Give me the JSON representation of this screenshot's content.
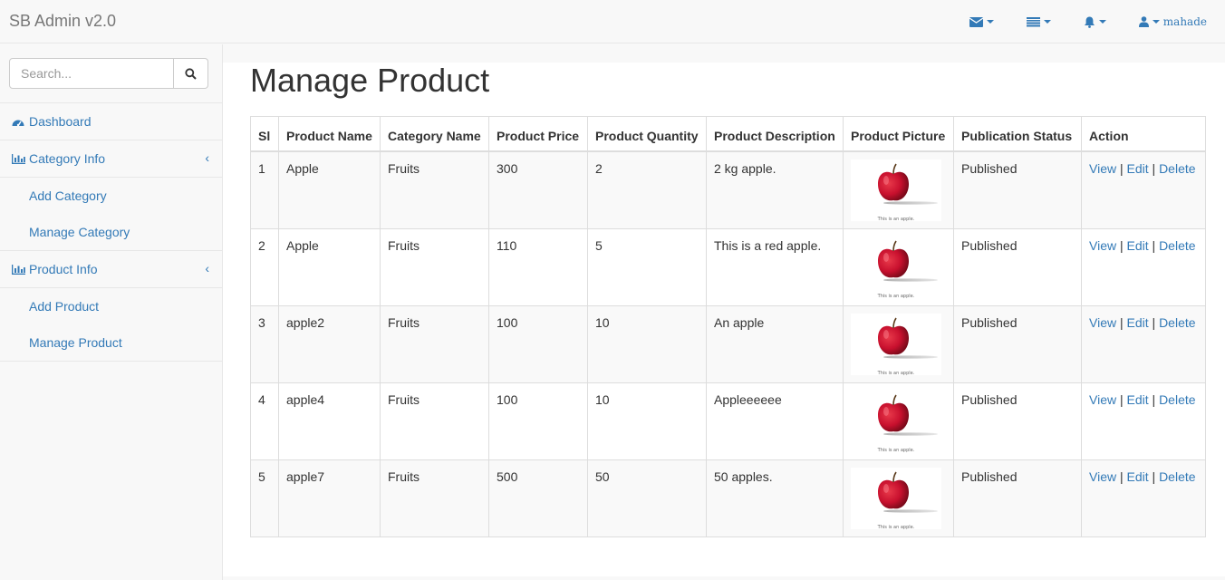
{
  "brand": "SB Admin v2.0",
  "user": {
    "name": "mahade"
  },
  "search": {
    "placeholder": "Search..."
  },
  "sidebar": {
    "dashboard": "Dashboard",
    "category_info": "Category Info",
    "add_category": "Add Category",
    "manage_category": "Manage Category",
    "product_info": "Product Info",
    "add_product": "Add Product",
    "manage_product": "Manage Product"
  },
  "page_title": "Manage Product",
  "table": {
    "headers": [
      "Sl",
      "Product Name",
      "Category Name",
      "Product Price",
      "Product Quantity",
      "Product Description",
      "Product Picture",
      "Publication Status",
      "Action"
    ],
    "picture_caption": "This is an apple.",
    "actions": {
      "view": "View",
      "edit": "Edit",
      "delete": "Delete",
      "separator": "|"
    },
    "rows": [
      {
        "sl": "1",
        "name": "Apple",
        "category": "Fruits",
        "price": "300",
        "quantity": "2",
        "description": "2 kg apple.",
        "status": "Published"
      },
      {
        "sl": "2",
        "name": "Apple",
        "category": "Fruits",
        "price": "110",
        "quantity": "5",
        "description": "This is a red apple.",
        "status": "Published"
      },
      {
        "sl": "3",
        "name": "apple2",
        "category": "Fruits",
        "price": "100",
        "quantity": "10",
        "description": "An apple",
        "status": "Published"
      },
      {
        "sl": "4",
        "name": "apple4",
        "category": "Fruits",
        "price": "100",
        "quantity": "10",
        "description": "Appleeeeee",
        "status": "Published"
      },
      {
        "sl": "5",
        "name": "apple7",
        "category": "Fruits",
        "price": "500",
        "quantity": "50",
        "description": "50 apples.",
        "status": "Published"
      }
    ]
  },
  "colors": {
    "link": "#337ab7",
    "apple": "#c8102e"
  }
}
